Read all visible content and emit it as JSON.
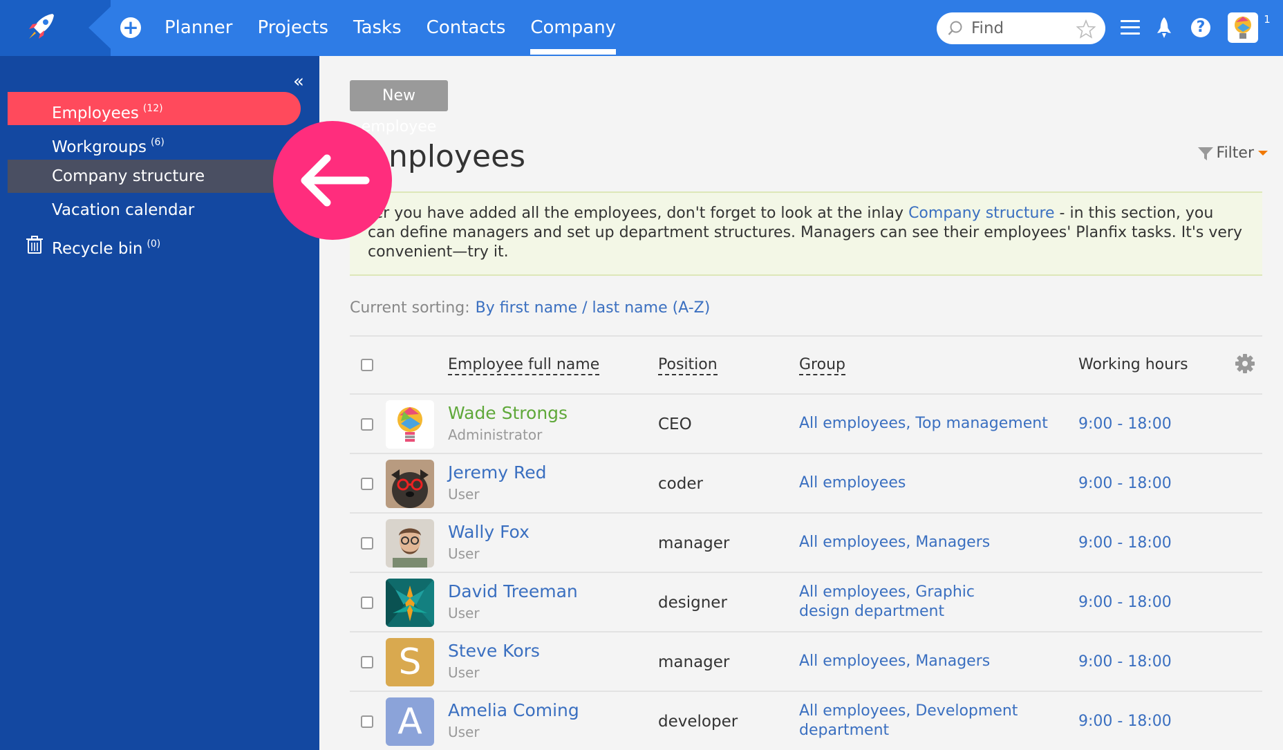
{
  "topbar": {
    "nav": [
      "Planner",
      "Projects",
      "Tasks",
      "Contacts",
      "Company"
    ],
    "active_nav": "Company",
    "search_placeholder": "Find",
    "notifications": "1",
    "colors": {
      "bar": "#2e7ce6",
      "logo_bg": "#1a5fc4"
    }
  },
  "sidebar": {
    "items": [
      {
        "label": "Employees",
        "count": "(12)"
      },
      {
        "label": "Workgroups",
        "count": "(6)"
      },
      {
        "label": "Company structure",
        "count": ""
      },
      {
        "label": "Vacation calendar",
        "count": ""
      },
      {
        "label": "Recycle bin",
        "count": "(0)"
      }
    ],
    "colors": {
      "bg": "#1348a1",
      "active": "#ff4a5c",
      "hover": "#4a4f62"
    }
  },
  "main": {
    "new_button": "New employee",
    "title": "nployees",
    "filter": "Filter",
    "hint": {
      "before": "ter you have added all the employees, don't forget to look at the inlay ",
      "link": "Company structure",
      "after": " - in this section, you can define managers and set up department structures. Managers can see their employees' Planfix tasks. It's very convenient—try it."
    },
    "sorting": {
      "label": "Current sorting:",
      "value": "By first name / last name (A-Z)"
    },
    "table": {
      "columns": [
        "Employee full name",
        "Position",
        "Group",
        "Working hours"
      ],
      "rows": [
        {
          "name": "Wade Strongs",
          "role": "Administrator",
          "position": "CEO",
          "groups": [
            "All employees",
            "Top management"
          ],
          "hours": "9:00 - 18:00",
          "avatar": "bulb-avatar"
        },
        {
          "name": "Jeremy Red",
          "role": "User",
          "position": "coder",
          "groups": [
            "All employees"
          ],
          "hours": "9:00 - 18:00",
          "avatar": "pug-avatar"
        },
        {
          "name": "Wally Fox",
          "role": "User",
          "position": "manager",
          "groups": [
            "All employees",
            "Managers"
          ],
          "hours": "9:00 - 18:00",
          "avatar": "man-glasses-avatar"
        },
        {
          "name": "David Treeman",
          "role": "User",
          "position": "designer",
          "groups": [
            "All employees",
            "Graphic design department"
          ],
          "hours": "9:00 - 18:00",
          "avatar": "plant-avatar"
        },
        {
          "name": "Steve Kors",
          "role": "User",
          "position": "manager",
          "groups": [
            "All employees",
            "Managers"
          ],
          "hours": "9:00 - 18:00",
          "avatar_letter": "S",
          "avatar_color": "#d9a94f"
        },
        {
          "name": "Amelia Coming",
          "role": "User",
          "position": "developer",
          "groups": [
            "All employees",
            "Development department"
          ],
          "hours": "9:00 - 18:00",
          "avatar_letter": "A",
          "avatar_color": "#8ba3d9"
        }
      ]
    },
    "colors": {
      "link": "#3a6fc0",
      "admin_name": "#5fa83a",
      "marker": "#ff2d7d"
    }
  }
}
